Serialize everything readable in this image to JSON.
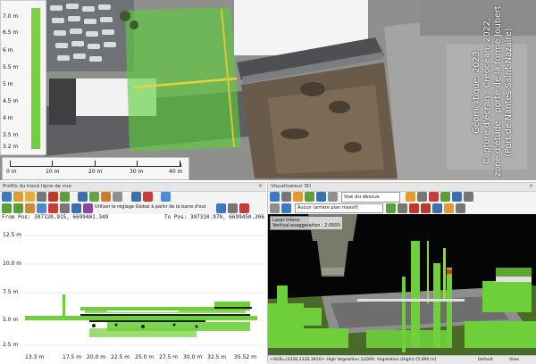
{
  "elevation_legend": {
    "labels": [
      "7.0 m",
      "6.5 m",
      "6 m",
      "5.5 m",
      "5 m",
      "4.5 m",
      "4 m",
      "3.5 m",
      "3.2 m"
    ]
  },
  "scale_bar": {
    "ticks": [
      "0 m",
      "10 m",
      "20 m",
      "30 m",
      "40 m"
    ]
  },
  "caption": {
    "line1": "Géom@tique, 2023.",
    "line2": "Capture d'écran : Créocéan, 2022,",
    "line3": "zone d'étude : porte de la forme Joubert",
    "line4": "(Port de Nantes Saint-Nazaire)."
  },
  "profile_panel": {
    "title": "Profils du tracé ligne de vue",
    "toolbar_text": "Utiliser le réglage Global à partir de la barre d'out",
    "from_pos": "From Pos: 307320.915, 6699401.349",
    "to_pos": "To Pos: 307310.970, 6699450.306",
    "y_labels": [
      "12.5 m",
      "10.0 m",
      "7.5 m",
      "5.0 m",
      "2.5 m"
    ],
    "x_labels": [
      "13.3 m",
      "17.5 m",
      "20.0 m",
      "22.5 m",
      "25.0 m",
      "27.5 m",
      "30.0 m",
      "32.5 m",
      "35.52 m"
    ]
  },
  "view3d_panel": {
    "title": "Visualisateur 3D",
    "view_select": "Vue du dessus",
    "mode_select": "Aucun (arrière plan massif)",
    "tooltip_line1": "Laser Intens",
    "tooltip_line2": "Vertical exaggeration : 2.0000",
    "status": "+RGB=(3328,3328,3816)• High Vegetation (LiDAR, Vegetation (High)) [5.890 m]",
    "status_right_1": "Default",
    "status_right_2": "View"
  },
  "colors": {
    "vegetation_green": "#6fcf3a",
    "accent_blue": "#2f6fb4"
  }
}
